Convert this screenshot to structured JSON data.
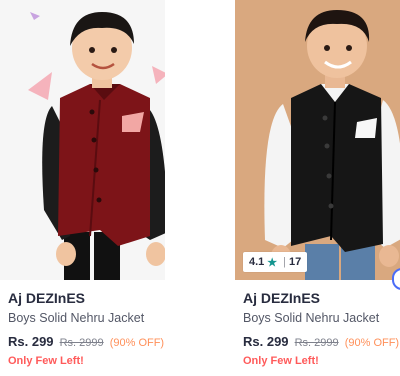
{
  "products": [
    {
      "brand": "Aj DEZInES",
      "title": "Boys Solid Nehru Jacket",
      "price": "Rs. 299",
      "mrp": "Rs. 2999",
      "discount": "(90% OFF)",
      "stock": "Only Few Left!",
      "image": "boy-red-nehru-jacket-photo",
      "colors": {
        "background": "#f6f6f6",
        "jacket": "#7d1418",
        "shirt": "#1a1a1a"
      }
    },
    {
      "brand": "Aj DEZInES",
      "title": "Boys Solid Nehru Jacket",
      "price": "Rs. 299",
      "mrp": "Rs. 2999",
      "discount": "(90% OFF)",
      "stock": "Only Few Left!",
      "image": "boy-black-nehru-jacket-photo",
      "rating": {
        "value": "4.1",
        "count": "17"
      },
      "colors": {
        "background": "#d9a87f",
        "jacket": "#161616",
        "shirt": "#f4f4f4"
      }
    }
  ],
  "colors": {
    "price": "#282c3f",
    "discount": "#ff905a",
    "stock": "#ff5a5a",
    "rating_star": "#14958f"
  }
}
